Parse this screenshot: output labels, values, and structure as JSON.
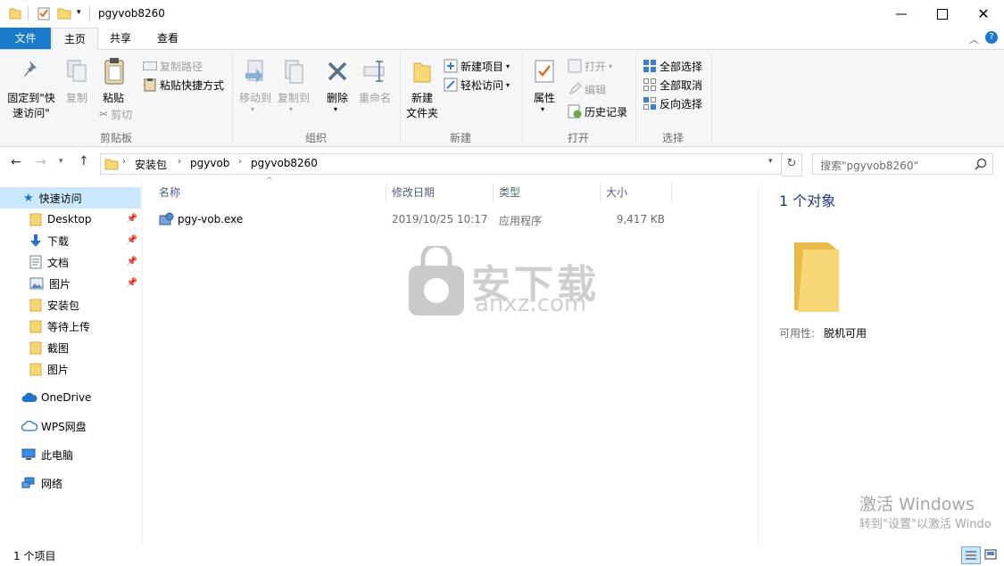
{
  "window": {
    "title": "pgyvob8260",
    "controls": [
      "minimize-icon",
      "maximize-icon",
      "close-icon"
    ]
  },
  "tabs": [
    {
      "label": "文件"
    },
    {
      "label": "主页"
    },
    {
      "label": "共享"
    },
    {
      "label": "查看"
    }
  ],
  "ribbon": {
    "clipboard": {
      "pin_label_1": "固定到\"快",
      "pin_label_2": "速访问\"",
      "copy": "复制",
      "paste": "粘贴",
      "copy_path": "复制路径",
      "paste_shortcut": "粘贴快捷方式",
      "cut": "剪切",
      "group": "剪贴板"
    },
    "organize": {
      "move_to": "移动到",
      "copy_to": "复制到",
      "delete": "删除",
      "rename": "重命名",
      "group": "组织"
    },
    "new": {
      "new_folder_1": "新建",
      "new_folder_2": "文件夹",
      "new_item": "新建项目",
      "easy_access": "轻松访问",
      "group": "新建"
    },
    "open": {
      "properties": "属性",
      "open": "打开",
      "edit": "编辑",
      "history": "历史记录",
      "group": "打开"
    },
    "select": {
      "select_all": "全部选择",
      "select_none": "全部取消",
      "invert": "反向选择",
      "group": "选择"
    }
  },
  "address": {
    "crumbs": [
      "安装包",
      "pgyvob",
      "pgyvob8260"
    ],
    "search_placeholder": "搜索\"pgyvob8260\""
  },
  "nav": {
    "quick_access": "快速访问",
    "items": [
      {
        "label": "Desktop"
      },
      {
        "label": "下载"
      },
      {
        "label": "文档"
      },
      {
        "label": "图片"
      },
      {
        "label": "安装包"
      },
      {
        "label": "等待上传"
      },
      {
        "label": "截图"
      },
      {
        "label": "图片"
      }
    ],
    "onedrive": "OneDrive",
    "wps": "WPS网盘",
    "pc": "此电脑",
    "network": "网络"
  },
  "columns": {
    "name": "名称",
    "date": "修改日期",
    "type": "类型",
    "size": "大小"
  },
  "files": [
    {
      "name": "pgy-vob.exe",
      "date": "2019/10/25 10:17",
      "type": "应用程序",
      "size": "9,417 KB"
    }
  ],
  "details": {
    "count": "1 个对象",
    "avail_label": "可用性:",
    "avail_value": "脱机可用"
  },
  "watermark": {
    "main": "安下载",
    "sub": "anxz.com"
  },
  "activation": {
    "line1": "激活 Windows",
    "line2": "转到\"设置\"以激活 Windo"
  },
  "status": {
    "items": "1 个项目"
  }
}
